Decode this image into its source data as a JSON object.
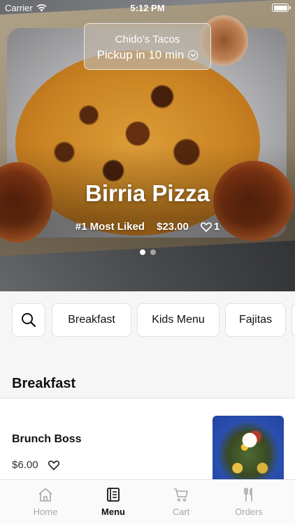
{
  "status_bar": {
    "carrier": "Carrier",
    "time": "5:12 PM"
  },
  "store": {
    "name": "Chido's Tacos",
    "pickup": "Pickup in 10 min"
  },
  "hero": {
    "title": "Birria Pizza",
    "badge": "#1 Most Liked",
    "price": "$23.00",
    "likes": "1",
    "carousel": {
      "count": 2,
      "active": 1
    }
  },
  "categories": [
    "Breakfast",
    "Kids Menu",
    "Fajitas"
  ],
  "section": {
    "title": "Breakfast"
  },
  "items": [
    {
      "name": "Brunch Boss",
      "price": "$6.00"
    }
  ],
  "tabs": [
    {
      "label": "Home",
      "icon": "house-icon"
    },
    {
      "label": "Menu",
      "icon": "menu-book-icon"
    },
    {
      "label": "Cart",
      "icon": "cart-icon"
    },
    {
      "label": "Orders",
      "icon": "fork-knife-icon"
    }
  ],
  "colors": {
    "active_tab": "#111111",
    "inactive_tab": "#a8a8a8",
    "background": "#f6f6f6"
  }
}
